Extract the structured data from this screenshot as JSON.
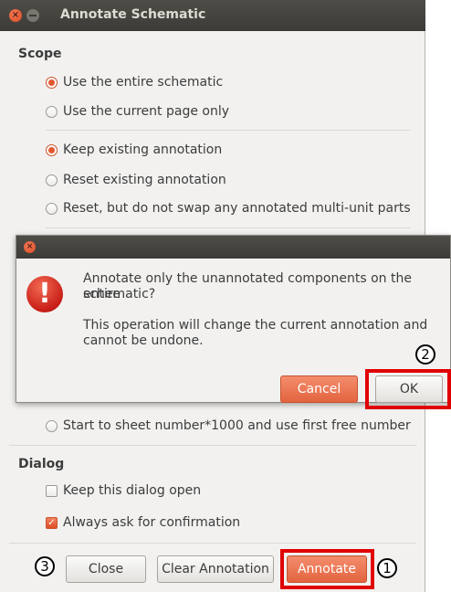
{
  "window": {
    "title": "Annotate Schematic",
    "close_glyph": "×"
  },
  "scope": {
    "title": "Scope",
    "options1": [
      "Use the entire schematic",
      "Use the current page only"
    ],
    "options2": [
      "Keep existing annotation",
      "Reset existing annotation",
      "Reset, but do not swap any annotated multi-unit parts"
    ],
    "options3": [
      "Start to  sheet number*1000 and use first free number"
    ]
  },
  "dialog_section": {
    "title": "Dialog",
    "keep_open": "Keep this dialog open",
    "always_ask": "Always ask for confirmation"
  },
  "buttons": {
    "close": "Close",
    "clear": "Clear Annotation",
    "annotate": "Annotate"
  },
  "modal": {
    "close_glyph": "×",
    "warning_glyph": "!",
    "message_line1": "Annotate only the unannotated components on the entire",
    "message_line2": "schematic?",
    "detail_line1": "This operation will change the current annotation and",
    "detail_line2": "cannot be undone.",
    "cancel": "Cancel",
    "ok": "OK"
  },
  "callouts": {
    "one": "1",
    "two": "2",
    "three": "3"
  },
  "colors": {
    "accent": "#e0572c",
    "highlight": "#e00000",
    "titlebar": "#3c3b37"
  }
}
